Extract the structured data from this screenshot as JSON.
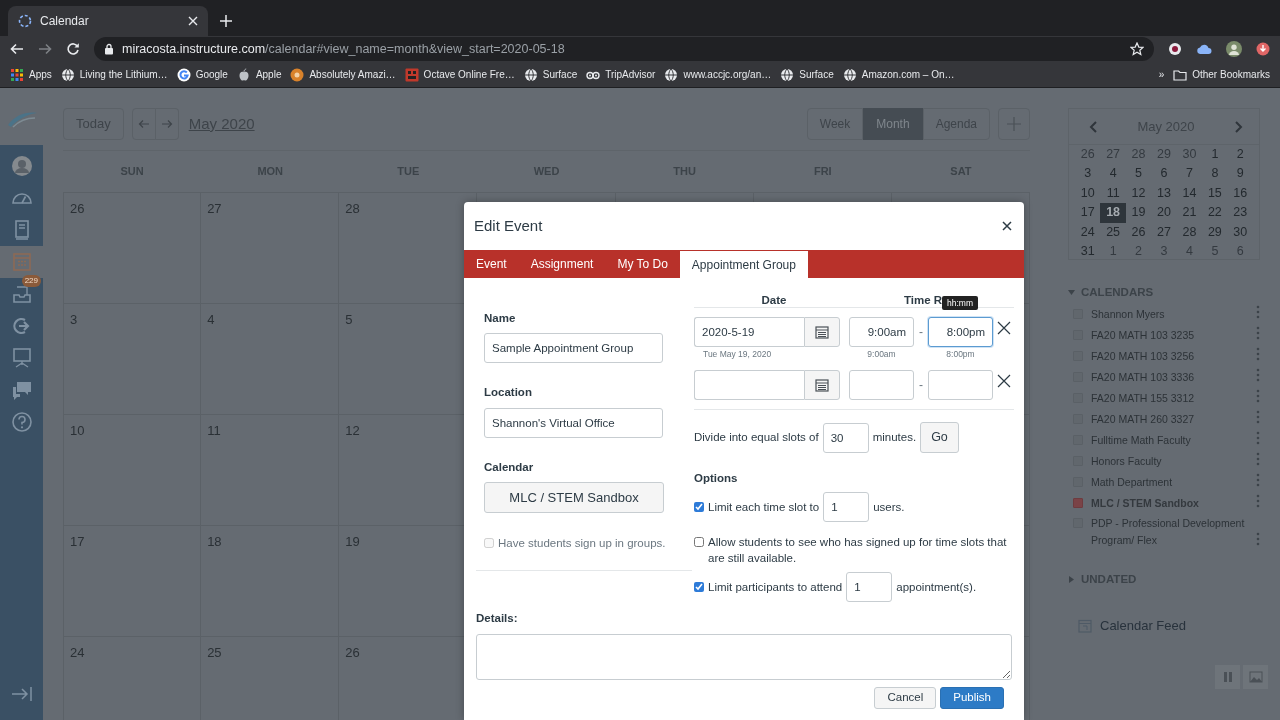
{
  "browser": {
    "tab_title": "Calendar",
    "url_domain": "miracosta.instructure.com",
    "url_path": "/calendar#view_name=month&view_start=2020-05-18",
    "bookmarks": [
      {
        "kind": "apps",
        "label": "Apps"
      },
      {
        "kind": "globe",
        "label": "Living the Lithium…"
      },
      {
        "kind": "ring",
        "label": "Google"
      },
      {
        "kind": "apple",
        "label": "Apple"
      },
      {
        "kind": "badge",
        "label": "Absolutely Amazi…"
      },
      {
        "kind": "box",
        "label": "Octave Online Fre…"
      },
      {
        "kind": "globe",
        "label": "Surface"
      },
      {
        "kind": "eyes",
        "label": "TripAdvisor"
      },
      {
        "kind": "globe",
        "label": "www.accjc.org/an…"
      },
      {
        "kind": "globe",
        "label": "Surface"
      },
      {
        "kind": "globe",
        "label": "Amazon.com – On…"
      }
    ],
    "more": "»",
    "other_bookmarks": "Other Bookmarks"
  },
  "nav": {
    "items": [
      {
        "kind": "avatar",
        "selected": false
      },
      {
        "kind": "gauge",
        "selected": false
      },
      {
        "kind": "book",
        "selected": false
      },
      {
        "kind": "calendar",
        "selected": true
      },
      {
        "kind": "inbox",
        "selected": false,
        "badge": "229"
      },
      {
        "kind": "arrow",
        "selected": false
      },
      {
        "kind": "monitor",
        "selected": false
      },
      {
        "kind": "chat",
        "selected": false
      },
      {
        "kind": "help",
        "selected": false
      }
    ]
  },
  "toolbar": {
    "today": "Today",
    "title": "May 2020",
    "views": [
      {
        "label": "Week",
        "selected": false
      },
      {
        "label": "Month",
        "selected": true
      },
      {
        "label": "Agenda",
        "selected": false
      }
    ]
  },
  "calendar": {
    "weekdays": [
      "SUN",
      "MON",
      "TUE",
      "WED",
      "THU",
      "FRI",
      "SAT"
    ],
    "weeks": [
      [
        "26",
        "27",
        "28"
      ],
      [
        "3",
        "4",
        "5"
      ],
      [
        "10",
        "11",
        "12"
      ],
      [
        "17",
        "18",
        "19"
      ],
      [
        "24",
        "25",
        "26"
      ]
    ]
  },
  "mini_calendar": {
    "title": "May 2020",
    "weeks": [
      [
        {
          "day": "26",
          "outside": true,
          "selected": false
        },
        {
          "day": "27",
          "outside": true,
          "selected": false
        },
        {
          "day": "28",
          "outside": true,
          "selected": false
        },
        {
          "day": "29",
          "outside": true,
          "selected": false
        },
        {
          "day": "30",
          "outside": true,
          "selected": false
        },
        {
          "day": "1",
          "outside": false,
          "selected": false
        },
        {
          "day": "2",
          "outside": false,
          "selected": false
        }
      ],
      [
        {
          "day": "3",
          "outside": false,
          "selected": false
        },
        {
          "day": "4",
          "outside": false,
          "selected": false
        },
        {
          "day": "5",
          "outside": false,
          "selected": false
        },
        {
          "day": "6",
          "outside": false,
          "selected": false
        },
        {
          "day": "7",
          "outside": false,
          "selected": false
        },
        {
          "day": "8",
          "outside": false,
          "selected": false
        },
        {
          "day": "9",
          "outside": false,
          "selected": false
        }
      ],
      [
        {
          "day": "10",
          "outside": false,
          "selected": false
        },
        {
          "day": "11",
          "outside": false,
          "selected": false
        },
        {
          "day": "12",
          "outside": false,
          "selected": false
        },
        {
          "day": "13",
          "outside": false,
          "selected": false
        },
        {
          "day": "14",
          "outside": false,
          "selected": false
        },
        {
          "day": "15",
          "outside": false,
          "selected": false
        },
        {
          "day": "16",
          "outside": false,
          "selected": false
        }
      ],
      [
        {
          "day": "17",
          "outside": false,
          "selected": false
        },
        {
          "day": "18",
          "outside": false,
          "selected": true
        },
        {
          "day": "19",
          "outside": false,
          "selected": false
        },
        {
          "day": "20",
          "outside": false,
          "selected": false
        },
        {
          "day": "21",
          "outside": false,
          "selected": false
        },
        {
          "day": "22",
          "outside": false,
          "selected": false
        },
        {
          "day": "23",
          "outside": false,
          "selected": false
        }
      ],
      [
        {
          "day": "24",
          "outside": false,
          "selected": false
        },
        {
          "day": "25",
          "outside": false,
          "selected": false
        },
        {
          "day": "26",
          "outside": false,
          "selected": false
        },
        {
          "day": "27",
          "outside": false,
          "selected": false
        },
        {
          "day": "28",
          "outside": false,
          "selected": false
        },
        {
          "day": "29",
          "outside": false,
          "selected": false
        },
        {
          "day": "30",
          "outside": false,
          "selected": false
        }
      ],
      [
        {
          "day": "31",
          "outside": false,
          "selected": false
        },
        {
          "day": "1",
          "outside": true,
          "selected": false
        },
        {
          "day": "2",
          "outside": true,
          "selected": false
        },
        {
          "day": "3",
          "outside": true,
          "selected": false
        },
        {
          "day": "4",
          "outside": true,
          "selected": false
        },
        {
          "day": "5",
          "outside": true,
          "selected": false
        },
        {
          "day": "6",
          "outside": true,
          "selected": false
        }
      ]
    ]
  },
  "calendars": {
    "heading": "CALENDARS",
    "expanded": true,
    "items": [
      {
        "label": "Shannon Myers",
        "checked": false
      },
      {
        "label": "FA20 MATH 103 3235",
        "checked": false
      },
      {
        "label": "FA20 MATH 103 3256",
        "checked": false
      },
      {
        "label": "FA20 MATH 103 3336",
        "checked": false
      },
      {
        "label": "FA20 MATH 155 3312",
        "checked": false
      },
      {
        "label": "FA20 MATH 260 3327",
        "checked": false
      },
      {
        "label": "Fulltime Math Faculty",
        "checked": false
      },
      {
        "label": "Honors Faculty",
        "checked": false
      },
      {
        "label": "Math Department",
        "checked": false
      },
      {
        "label": "MLC / STEM Sandbox",
        "checked": true
      },
      {
        "label": "PDP - Professional Development Program/ Flex",
        "checked": false
      }
    ]
  },
  "undated": {
    "heading": "UNDATED",
    "expanded": false
  },
  "calendar_feed": "Calendar Feed",
  "modal": {
    "title": "Edit Event",
    "tabs": [
      {
        "label": "Event",
        "selected": false
      },
      {
        "label": "Assignment",
        "selected": false
      },
      {
        "label": "My To Do",
        "selected": false
      },
      {
        "label": "Appointment Group",
        "selected": true
      }
    ],
    "name": {
      "label": "Name",
      "value": "Sample Appointment Group"
    },
    "location": {
      "label": "Location",
      "value": "Shannon's Virtual Office"
    },
    "calendar": {
      "label": "Calendar",
      "value": "MLC / STEM Sandbox"
    },
    "group_signup": {
      "label": "Have students sign up in groups.",
      "checked": false,
      "disabled": true
    },
    "date_header": "Date",
    "time_header": "Time R",
    "tooltip": "hh:mm",
    "time_slots": [
      {
        "date": "2020-5-19",
        "start": "9:00am",
        "separator": "-",
        "end": "8:00pm",
        "date_hint": "Tue May 19, 2020",
        "start_hint": "9:00am",
        "end_hint": "8:00pm",
        "end_focused": true
      },
      {
        "separator": "-",
        "end_focused": false
      }
    ],
    "divide": {
      "label": "Divide into equal slots of",
      "value": "30",
      "suffix": "minutes.",
      "button": "Go"
    },
    "options_heading": "Options",
    "options": [
      {
        "kind": "limit",
        "checked": true,
        "label": "Limit each time slot to",
        "value": "1",
        "suffix": "users."
      },
      {
        "kind": "plain",
        "checked": false,
        "label": "Allow students to see who has signed up for time slots that are still available."
      },
      {
        "kind": "limit",
        "checked": true,
        "label": "Limit participants to attend",
        "value": "1",
        "suffix": "appointment(s)."
      }
    ],
    "details_label": "Details:",
    "buttons": [
      {
        "kind": "secondary",
        "label": "Cancel"
      },
      {
        "kind": "primary",
        "label": "Publish"
      }
    ]
  }
}
